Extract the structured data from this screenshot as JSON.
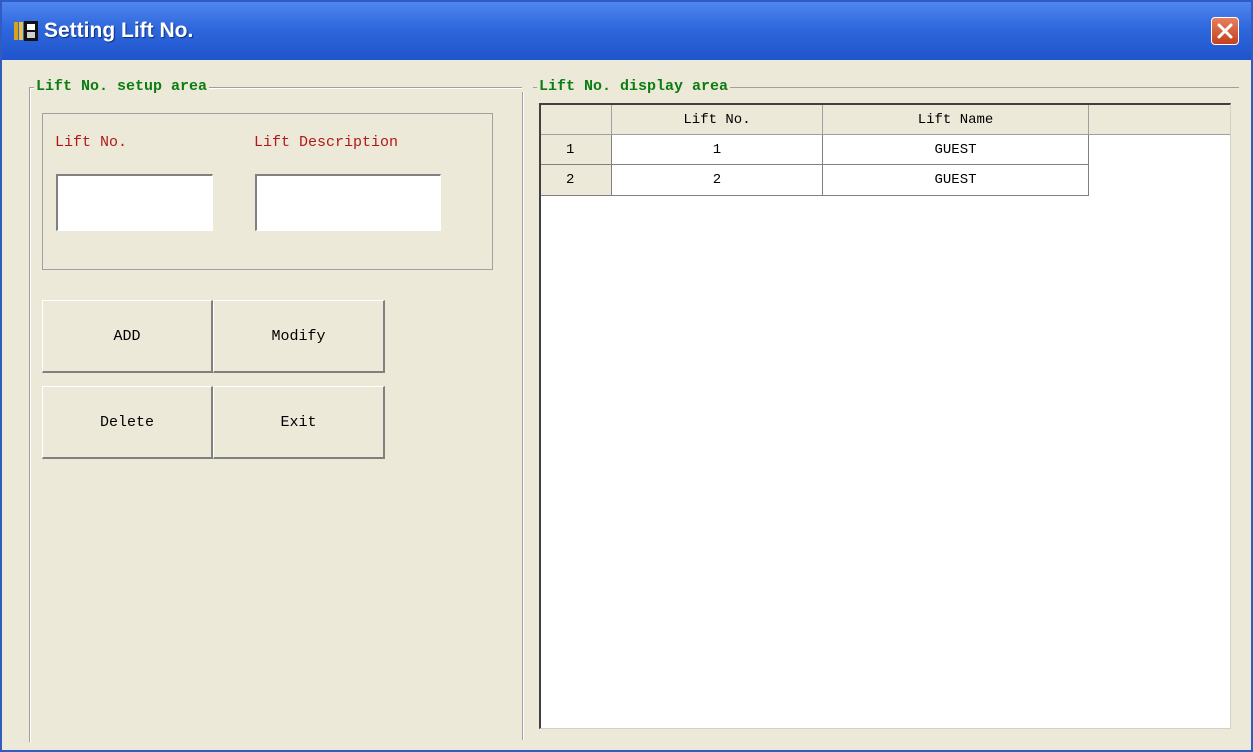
{
  "window": {
    "title": "Setting Lift No."
  },
  "setup_area": {
    "title": "Lift No. setup area",
    "lift_no_label": "Lift No.",
    "lift_description_label": "Lift Description",
    "lift_no_value": "",
    "lift_description_value": ""
  },
  "buttons": {
    "add": "ADD",
    "modify": "Modify",
    "delete": "Delete",
    "exit": "Exit"
  },
  "display_area": {
    "title": "Lift No. display area",
    "columns": [
      "Lift No.",
      "Lift Name"
    ],
    "rows": [
      {
        "index": "1",
        "lift_no": "1",
        "lift_name": "GUEST"
      },
      {
        "index": "2",
        "lift_no": "2",
        "lift_name": "GUEST"
      }
    ]
  },
  "colors": {
    "group_title": "#0b7d12",
    "field_label": "#b0191a",
    "titlebar": "#2f67dd",
    "window_bg": "#ece9d8"
  },
  "icons": {
    "app": "lift-app-icon",
    "close": "close-icon"
  }
}
